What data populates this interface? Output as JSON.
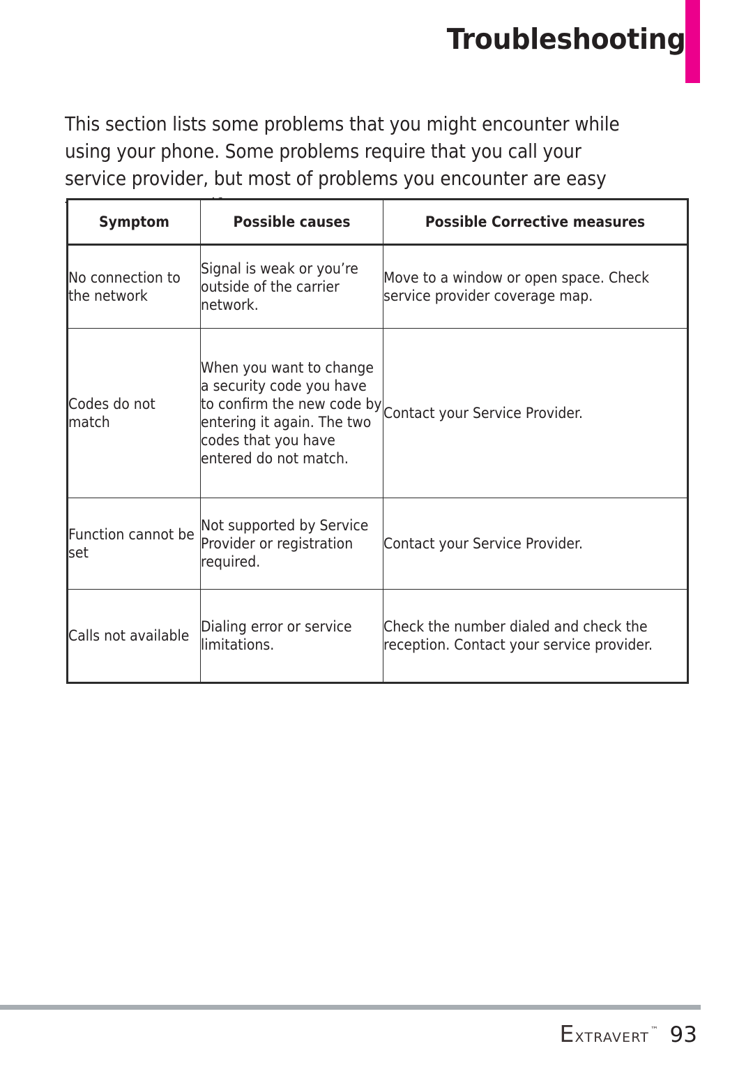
{
  "header": {
    "chapter_title": "Troubleshooting",
    "accent_color": "#ec008c"
  },
  "intro": {
    "paragraph": "This section lists some problems that you might encounter while using your phone. Some problems require that you call your service provider, but most of problems you encounter are easy to correct yourself."
  },
  "table": {
    "columns": [
      "Symptom",
      "Possible causes",
      "Possible Corrective measures"
    ],
    "rows": [
      {
        "symptom": "No connection to the network",
        "cause": "Signal is weak or you’re outside of the carrier network.",
        "measure": "Move to a window or open space. Check service provider coverage map."
      },
      {
        "symptom": "Codes do not match",
        "cause": "When you want to change a security code you have to confirm the new code by entering it again. The two codes that you have entered do not match.",
        "measure": "Contact your Service Provider."
      },
      {
        "symptom": "Function cannot be set",
        "cause": "Not supported by Service Provider or registration required.",
        "measure": "Contact your Service Provider."
      },
      {
        "symptom": "Calls not available",
        "cause": "Dialing error or service limitations.",
        "measure": "Check the number dialed and check the reception. Contact your service provider."
      }
    ]
  },
  "footer": {
    "brand_first_letter": "E",
    "brand_rest": "xtravert",
    "trademark": "™",
    "page_number": "93",
    "rule_color": "#a7adb2"
  }
}
